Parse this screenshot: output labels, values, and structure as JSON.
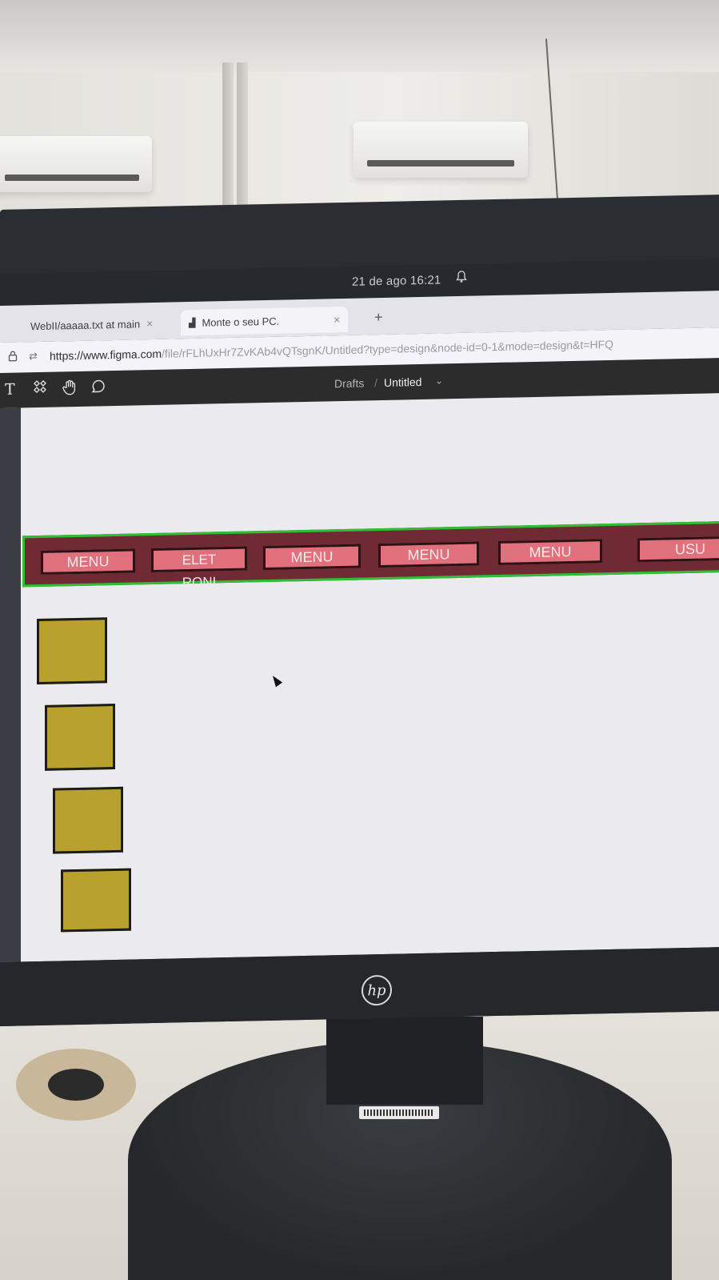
{
  "system_bar": {
    "datetime": "21 de ago  16:21",
    "notification_icon": "bell-icon"
  },
  "browser": {
    "tabs": [
      {
        "label": "WebII/aaaaa.txt at main",
        "close": "×"
      },
      {
        "label": "Monte o seu PC.",
        "close": "×"
      }
    ],
    "new_tab": "+",
    "url_host": "https://www.figma.com",
    "url_path": "/file/rFLhUxHr7ZvKAb4vQTsgnK/Untitled?type=design&node-id=0-1&mode=design&t=HFQ"
  },
  "figma": {
    "tools": [
      "text-tool-icon",
      "components-icon",
      "hand-tool-icon",
      "comment-icon"
    ],
    "text_tool_glyph": "T",
    "breadcrumb_parent": "Drafts",
    "breadcrumb_sep": "/",
    "file_title": "Untitled",
    "title_caret": "⌄"
  },
  "canvas": {
    "menu_buttons": [
      {
        "label": "MENU"
      },
      {
        "line1": "ELET",
        "line2": "RONI"
      },
      {
        "label": "MENU"
      },
      {
        "label": "MENU"
      },
      {
        "label": "MENU"
      },
      {
        "label": "USU"
      }
    ],
    "square_count": 4
  },
  "hardware": {
    "brand": "hp"
  }
}
